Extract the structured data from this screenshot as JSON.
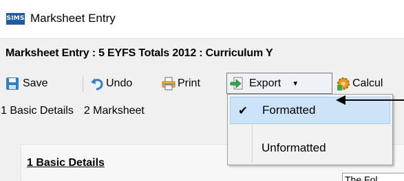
{
  "window": {
    "app_logo_text": "SIMS",
    "title": "Marksheet Entry"
  },
  "page": {
    "heading": "Marksheet Entry : 5 EYFS Totals 2012 : Curriculum Y"
  },
  "toolbar": {
    "save_label": "Save",
    "undo_label": "Undo",
    "print_label": "Print",
    "export_label": "Export",
    "calculate_label": "Calcul"
  },
  "nav": {
    "tab1": "1 Basic Details",
    "tab2": "2 Marksheet"
  },
  "export_menu": {
    "items": [
      {
        "label": "Formatted",
        "checked": true
      },
      {
        "label": "Unformatted",
        "checked": false
      }
    ]
  },
  "section": {
    "title": "1 Basic Details",
    "peek_text": "The Fol"
  },
  "colors": {
    "accent": "#1e5aa8",
    "selected_bg": "#cce4f7",
    "panel_bg": "#f0f0f0"
  }
}
